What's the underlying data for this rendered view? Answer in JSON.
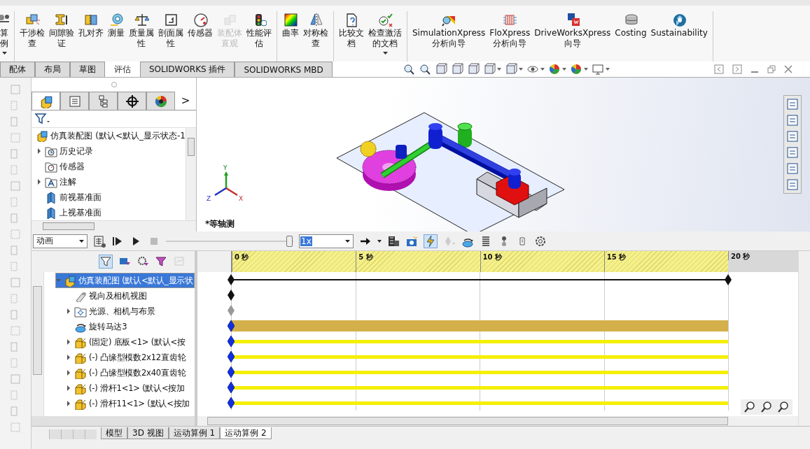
{
  "ribbon": {
    "groups": [
      {
        "items": [
          {
            "label": "算例",
            "disabled": false,
            "dropdown": true
          }
        ]
      },
      {
        "items": [
          {
            "label": "干涉检查",
            "disabled": false,
            "dropdown": false
          },
          {
            "label": "间隙验证",
            "disabled": false,
            "dropdown": false
          },
          {
            "label": "孔对齐",
            "disabled": false,
            "dropdown": false
          },
          {
            "label": "测量",
            "disabled": false,
            "dropdown": false
          },
          {
            "label": "质量属性",
            "disabled": false,
            "dropdown": false
          },
          {
            "label": "剖面属性",
            "disabled": false,
            "dropdown": false
          },
          {
            "label": "传感器",
            "disabled": false,
            "dropdown": false
          },
          {
            "label": "装配体直观",
            "disabled": true,
            "dropdown": false
          },
          {
            "label": "性能评估",
            "disabled": false,
            "dropdown": false
          }
        ]
      },
      {
        "items": [
          {
            "label": "曲率",
            "disabled": false,
            "dropdown": false
          },
          {
            "label": "对称检查",
            "disabled": false,
            "dropdown": false
          }
        ]
      },
      {
        "items": [
          {
            "label": "比较文档",
            "disabled": false,
            "dropdown": false
          },
          {
            "label": "检查激活的文档",
            "disabled": false,
            "dropdown": true
          }
        ]
      },
      {
        "items": [
          {
            "label": "SimulationXpress\n分析向导",
            "disabled": false,
            "dropdown": false
          },
          {
            "label": "FloXpress\n分析向导",
            "disabled": false,
            "dropdown": false
          },
          {
            "label": "DriveWorksXpress\n向导",
            "disabled": false,
            "dropdown": false
          },
          {
            "label": "Costing",
            "disabled": false,
            "dropdown": false
          },
          {
            "label": "Sustainability",
            "disabled": false,
            "dropdown": false
          }
        ]
      }
    ]
  },
  "tabs": [
    {
      "label": "配体",
      "selected": false
    },
    {
      "label": "布局",
      "selected": false
    },
    {
      "label": "草图",
      "selected": false
    },
    {
      "label": "评估",
      "selected": true
    },
    {
      "label": "SOLIDWORKS 插件",
      "selected": false
    },
    {
      "label": "SOLIDWORKS MBD",
      "selected": false
    }
  ],
  "feature_manager": {
    "more": ">",
    "tree": [
      {
        "kind": "assembly",
        "label": "仿真装配图  (默认<默认_显示状态-1"
      },
      {
        "kind": "history",
        "label": "历史记录",
        "expanded": false
      },
      {
        "kind": "sensors",
        "label": "传感器"
      },
      {
        "kind": "annotations",
        "label": "注解",
        "expanded": false
      },
      {
        "kind": "plane",
        "label": "前视基准面"
      },
      {
        "kind": "plane",
        "label": "上视基准面"
      }
    ]
  },
  "viewport": {
    "view_name": "*等轴测",
    "triad": {
      "x": "X",
      "y": "Y",
      "z": "Z"
    }
  },
  "motion_manager": {
    "study_type": "动画",
    "playback": {
      "level": 0.97
    },
    "speed": "1x",
    "ticks": [
      "0 秒",
      "5 秒",
      "10 秒",
      "15 秒",
      "20 秒"
    ],
    "rows": [
      {
        "kind": "assembly",
        "label": "仿真装配图  (默认<默认_显示状",
        "expanded": true,
        "selected": true
      },
      {
        "kind": "view",
        "label": "视向及相机视图",
        "selected": false
      },
      {
        "kind": "lights",
        "label": "光源、相机与布景",
        "expanded": false,
        "selected": false
      },
      {
        "kind": "motor",
        "label": "旋转马达3",
        "selected": false
      },
      {
        "kind": "part",
        "label": "(固定) 底板<1> (默认<按",
        "expanded": false,
        "selected": false
      },
      {
        "kind": "part",
        "label": "(-) 凸缘型模数2x12直齿轮",
        "expanded": false,
        "selected": false
      },
      {
        "kind": "part",
        "label": "(-) 凸缘型模数2x40直齿轮",
        "expanded": false,
        "selected": false
      },
      {
        "kind": "part",
        "label": "(-) 滑杆1<1> (默认<按加",
        "expanded": false,
        "selected": false
      },
      {
        "kind": "part",
        "label": "(-) 滑杆11<1> (默认<按加",
        "expanded": false,
        "selected": false
      }
    ],
    "tabs": [
      {
        "label": "模型",
        "selected": false
      },
      {
        "label": "3D 视图",
        "selected": false
      },
      {
        "label": "运动算例 1",
        "selected": false
      },
      {
        "label": "运动算例 2",
        "selected": true
      }
    ]
  }
}
